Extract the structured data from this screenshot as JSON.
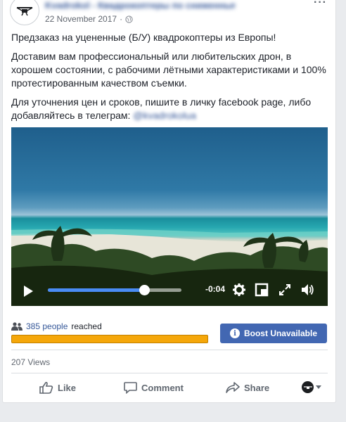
{
  "header": {
    "page_name": "Kvadrokol - Квадрокоптеры по сниженным ценам",
    "date": "22 November 2017",
    "separator": "·"
  },
  "post": {
    "paragraphs": [
      "Предзаказ на уцененные (Б/У) квадрокоптеры из Европы!",
      "Доставим вам профессиональный или любительских дрон, в хорошем состоянии, с рабочими лётными характеристиками и 100% протестированным качеством съемки.",
      "Для уточнения цен и сроков, пишите в личку facebook page, либо добавляйтесь в телеграм:"
    ],
    "telegram_handle": "@kvadrokolua"
  },
  "video": {
    "time_remaining": "-0:04",
    "progress": 0.72
  },
  "reach": {
    "count_label": "385 people",
    "suffix": "reached"
  },
  "boost": {
    "label": "Boost Unavailable"
  },
  "views": "207 Views",
  "actions": {
    "like": "Like",
    "comment": "Comment",
    "share": "Share"
  },
  "colors": {
    "link": "#365899",
    "boost": "#4267b2",
    "reach_bar": "#f5a70a",
    "progress": "#4a8cf5"
  }
}
